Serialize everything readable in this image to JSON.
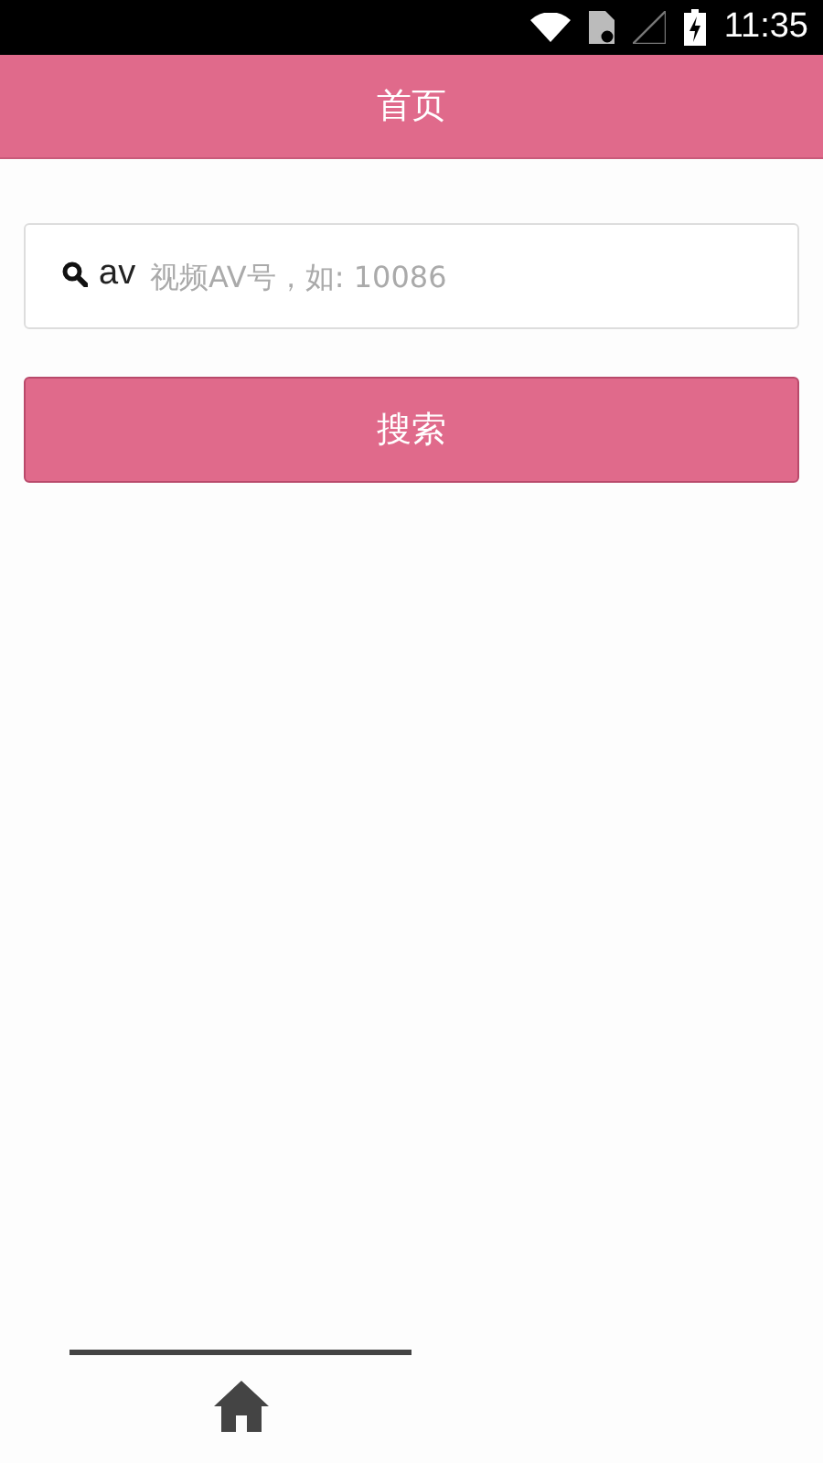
{
  "status_bar": {
    "time": "11:35"
  },
  "header": {
    "title": "首页"
  },
  "search": {
    "prefix": "av",
    "placeholder": "视频AV号，如: 10086"
  },
  "search_button": {
    "label": "搜索"
  },
  "bottom_tabs": [
    {
      "kind": "home",
      "selected": true
    }
  ]
}
